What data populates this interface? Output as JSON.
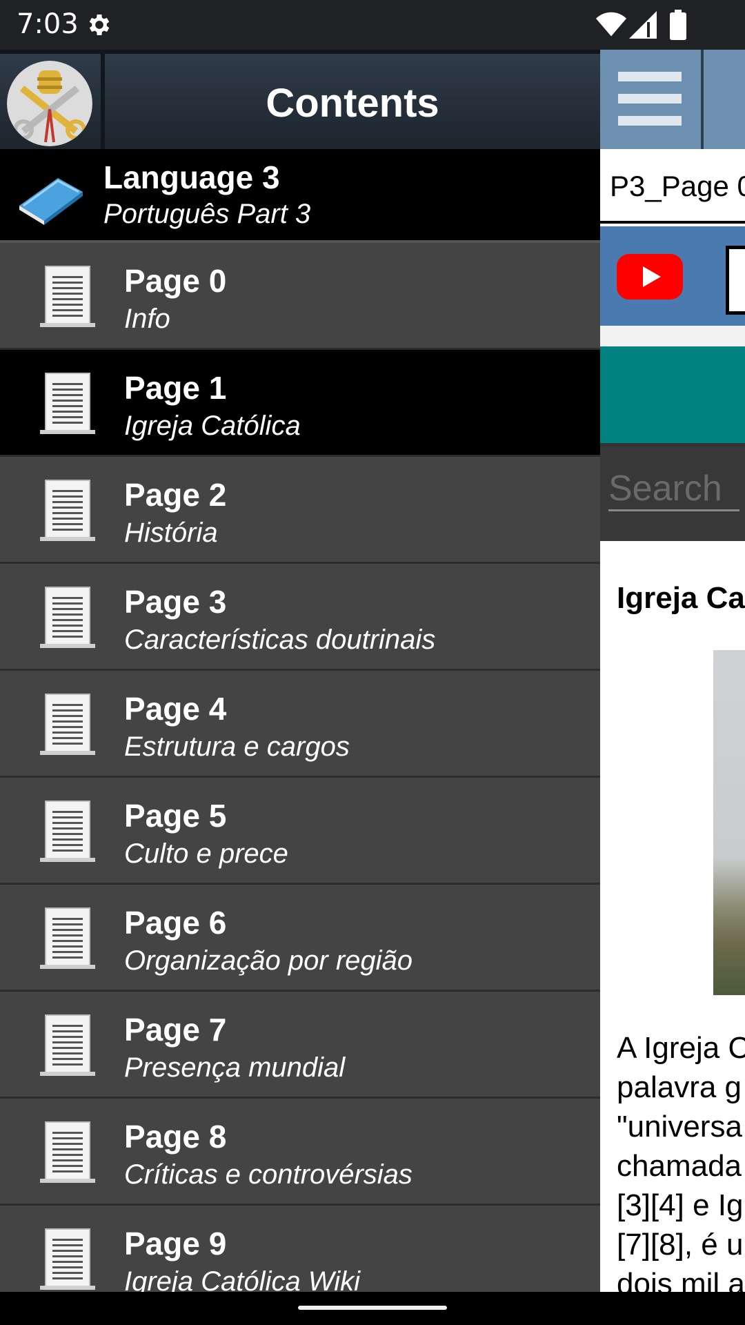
{
  "status_bar": {
    "time": "7:03",
    "icons": [
      "settings-gear-icon",
      "wifi-icon",
      "cell-signal-icon",
      "battery-icon"
    ]
  },
  "drawer": {
    "title": "Contents",
    "logo_icon": "vatican-coat-of-arms-icon",
    "language": {
      "title": "Language 3",
      "subtitle": "Português Part 3",
      "icon": "book-icon"
    },
    "selected_index": 1,
    "items": [
      {
        "title": "Page 0",
        "subtitle": "Info"
      },
      {
        "title": "Page 1",
        "subtitle": "Igreja Católica"
      },
      {
        "title": "Page 2",
        "subtitle": "História"
      },
      {
        "title": "Page 3",
        "subtitle": "Características doutrinais"
      },
      {
        "title": "Page 4",
        "subtitle": "Estrutura e cargos"
      },
      {
        "title": "Page 5",
        "subtitle": "Culto e prece"
      },
      {
        "title": "Page 6",
        "subtitle": "Organização por região"
      },
      {
        "title": "Page 7",
        "subtitle": "Presença mundial"
      },
      {
        "title": "Page 8",
        "subtitle": "Críticas e controvérsias"
      },
      {
        "title": "Page 9",
        "subtitle": "Igreja Católica Wiki"
      }
    ]
  },
  "background_app": {
    "page_label": "P3_Page 0",
    "search_placeholder": "Search",
    "article_title": "Igreja Ca",
    "paragraph_lines": [
      "A Igreja C",
      "palavra g",
      "\"universa",
      "chamada",
      "[3][4] e Ig",
      "[7][8], é u",
      "dois mil a"
    ],
    "colors": {
      "toolbar": "#2c3e50",
      "menu_button": "#6d8fb0",
      "links_bar": "#4a7ab0",
      "teal_banner": "#00807f"
    }
  }
}
